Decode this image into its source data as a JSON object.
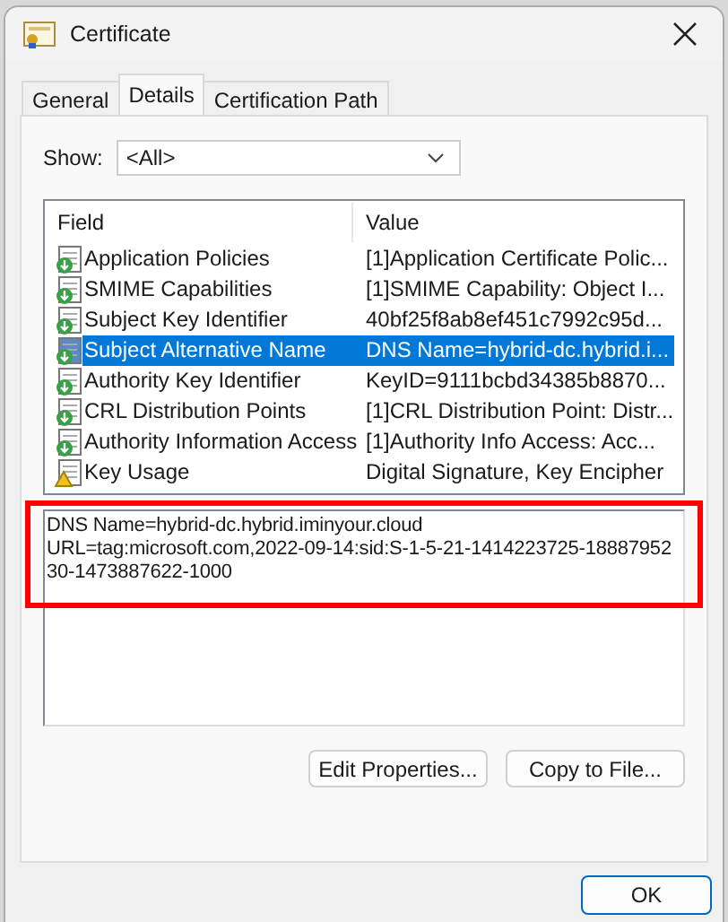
{
  "window": {
    "title": "Certificate"
  },
  "tabs": [
    {
      "label": "General",
      "selected": false
    },
    {
      "label": "Details",
      "selected": true
    },
    {
      "label": "Certification Path",
      "selected": false
    }
  ],
  "show": {
    "label": "Show:",
    "value": "<All>"
  },
  "table": {
    "columns": [
      "Field",
      "Value"
    ],
    "rows": [
      {
        "field": "Application Policies",
        "value": "[1]Application Certificate Polic...",
        "kind": "extension",
        "selected": false
      },
      {
        "field": "SMIME Capabilities",
        "value": "[1]SMIME Capability: Object I...",
        "kind": "extension",
        "selected": false
      },
      {
        "field": "Subject Key Identifier",
        "value": "40bf25f8ab8ef451c7992c95d...",
        "kind": "extension",
        "selected": false
      },
      {
        "field": "Subject Alternative Name",
        "value": "DNS Name=hybrid-dc.hybrid.i...",
        "kind": "extension",
        "selected": true
      },
      {
        "field": "Authority Key Identifier",
        "value": "KeyID=9111bcbd34385b8870...",
        "kind": "extension",
        "selected": false
      },
      {
        "field": "CRL Distribution Points",
        "value": "[1]CRL Distribution Point: Distr...",
        "kind": "extension",
        "selected": false
      },
      {
        "field": "Authority Information Access",
        "value": "[1]Authority Info Access: Acc...",
        "kind": "extension",
        "selected": false
      },
      {
        "field": "Key Usage",
        "value": "Digital Signature, Key Encipher",
        "kind": "critical",
        "selected": false
      }
    ]
  },
  "detail": {
    "lines": [
      "DNS Name=hybrid-dc.hybrid.iminyour.cloud",
      "URL=tag:microsoft.com,2022-09-14:sid:S-1-5-21-1414223725-1888795230-1473887622-1000"
    ],
    "highlighted": true
  },
  "buttons": [
    "Edit Properties...",
    "Copy to File..."
  ],
  "ok_button": "OK"
}
